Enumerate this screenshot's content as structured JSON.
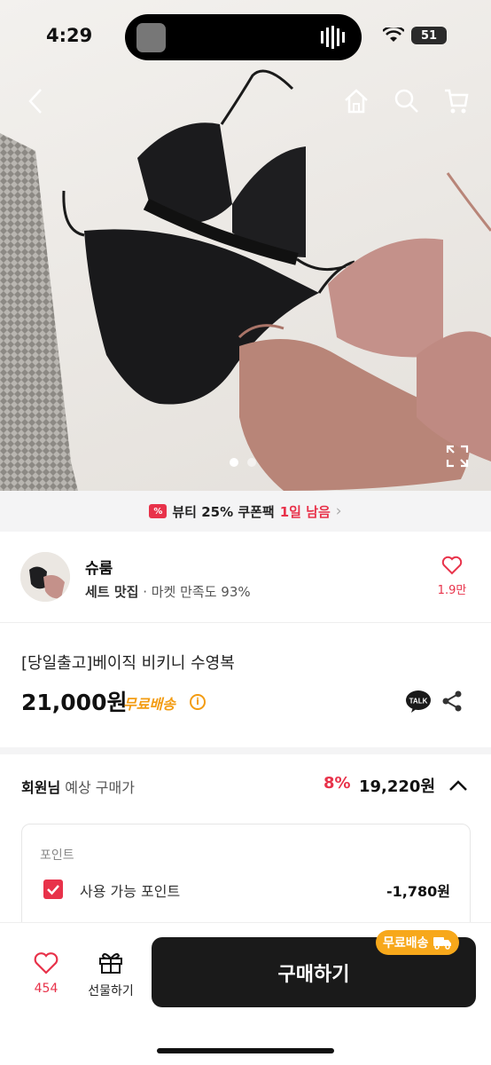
{
  "status_bar": {
    "time": "4:29",
    "battery": "51"
  },
  "nav": {
    "back_icon": "chevron-left-icon",
    "home_icon": "home-icon",
    "search_icon": "search-icon",
    "cart_icon": "cart-icon"
  },
  "gallery": {
    "total_images": 2,
    "current_index": 1
  },
  "coupon": {
    "prefix": "뷰티 25% 쿠폰팩",
    "highlight": "1일 남음",
    "accent": "#e8324a"
  },
  "shop": {
    "name": "슈룸",
    "tag": "세트 맛집",
    "sub": " · 마켓 만족도 93%",
    "likes": "1.9만"
  },
  "product": {
    "title": "[당일출고]베이직 비키니 수영복",
    "price": "21,000원",
    "shipping": "무료배송"
  },
  "member_price": {
    "prefix": "회원님",
    "label": " 예상 구매가",
    "discount": "8%",
    "price": "19,220원"
  },
  "points": {
    "section_label": "포인트",
    "item_label": "사용 가능 포인트",
    "amount": "-1,780원",
    "checked": true
  },
  "bottom_bar": {
    "wish_count": "454",
    "gift_label": "선물하기",
    "buy_label": "구매하기",
    "badge": "무료배송"
  },
  "colors": {
    "accent_red": "#e8324a",
    "shipping_orange": "#f39c12",
    "buy_button": "#1a1a1a"
  }
}
